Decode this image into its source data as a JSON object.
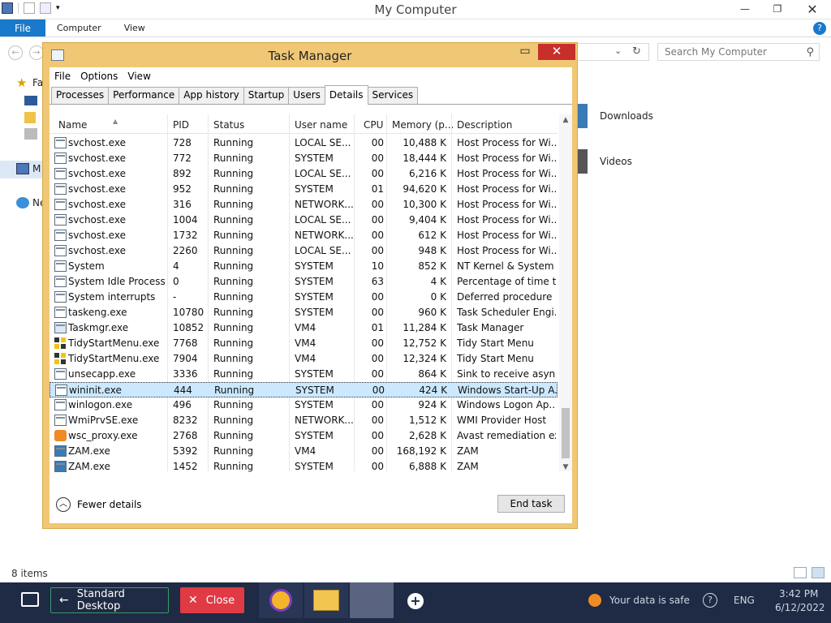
{
  "explorer": {
    "title": "My Computer",
    "ribbon_tabs": [
      "File",
      "Computer",
      "View"
    ],
    "help": "?",
    "search_placeholder": "Search My Computer",
    "sidebar": [
      {
        "label": "Fa",
        "icon": "star-icon"
      },
      {
        "label": "M",
        "icon": "computer-icon"
      },
      {
        "label": "Ne",
        "icon": "network-icon"
      }
    ],
    "folders": [
      {
        "label": "Downloads",
        "icon": "downloads-folder-icon"
      },
      {
        "label": "Videos",
        "icon": "videos-folder-icon"
      }
    ],
    "status_items": "8 items"
  },
  "taskmanager": {
    "title": "Task Manager",
    "menu": [
      "File",
      "Options",
      "View"
    ],
    "tabs": [
      "Processes",
      "Performance",
      "App history",
      "Startup",
      "Users",
      "Details",
      "Services"
    ],
    "active_tab": "Details",
    "columns": [
      "Name",
      "PID",
      "Status",
      "User name",
      "CPU",
      "Memory (p...",
      "Description"
    ],
    "rows": [
      {
        "name": "svchost.exe",
        "pid": "728",
        "status": "Running",
        "user": "LOCAL SE...",
        "cpu": "00",
        "mem": "10,488 K",
        "desc": "Host Process for Wi...",
        "icon": "generic"
      },
      {
        "name": "svchost.exe",
        "pid": "772",
        "status": "Running",
        "user": "SYSTEM",
        "cpu": "00",
        "mem": "18,444 K",
        "desc": "Host Process for Wi...",
        "icon": "generic"
      },
      {
        "name": "svchost.exe",
        "pid": "892",
        "status": "Running",
        "user": "LOCAL SE...",
        "cpu": "00",
        "mem": "6,216 K",
        "desc": "Host Process for Wi...",
        "icon": "generic"
      },
      {
        "name": "svchost.exe",
        "pid": "952",
        "status": "Running",
        "user": "SYSTEM",
        "cpu": "01",
        "mem": "94,620 K",
        "desc": "Host Process for Wi...",
        "icon": "generic"
      },
      {
        "name": "svchost.exe",
        "pid": "316",
        "status": "Running",
        "user": "NETWORK...",
        "cpu": "00",
        "mem": "10,300 K",
        "desc": "Host Process for Wi...",
        "icon": "generic"
      },
      {
        "name": "svchost.exe",
        "pid": "1004",
        "status": "Running",
        "user": "LOCAL SE...",
        "cpu": "00",
        "mem": "9,404 K",
        "desc": "Host Process for Wi...",
        "icon": "generic"
      },
      {
        "name": "svchost.exe",
        "pid": "1732",
        "status": "Running",
        "user": "NETWORK...",
        "cpu": "00",
        "mem": "612 K",
        "desc": "Host Process for Wi...",
        "icon": "generic"
      },
      {
        "name": "svchost.exe",
        "pid": "2260",
        "status": "Running",
        "user": "LOCAL SE...",
        "cpu": "00",
        "mem": "948 K",
        "desc": "Host Process for Wi...",
        "icon": "generic"
      },
      {
        "name": "System",
        "pid": "4",
        "status": "Running",
        "user": "SYSTEM",
        "cpu": "10",
        "mem": "852 K",
        "desc": "NT Kernel & System",
        "icon": "generic"
      },
      {
        "name": "System Idle Process",
        "pid": "0",
        "status": "Running",
        "user": "SYSTEM",
        "cpu": "63",
        "mem": "4 K",
        "desc": "Percentage of time t...",
        "icon": "generic"
      },
      {
        "name": "System interrupts",
        "pid": "-",
        "status": "Running",
        "user": "SYSTEM",
        "cpu": "00",
        "mem": "0 K",
        "desc": "Deferred procedure ...",
        "icon": "generic"
      },
      {
        "name": "taskeng.exe",
        "pid": "10780",
        "status": "Running",
        "user": "SYSTEM",
        "cpu": "00",
        "mem": "960 K",
        "desc": "Task Scheduler Engi...",
        "icon": "generic"
      },
      {
        "name": "Taskmgr.exe",
        "pid": "10852",
        "status": "Running",
        "user": "VM4",
        "cpu": "01",
        "mem": "11,284 K",
        "desc": "Task Manager",
        "icon": "tm"
      },
      {
        "name": "TidyStartMenu.exe",
        "pid": "7768",
        "status": "Running",
        "user": "VM4",
        "cpu": "00",
        "mem": "12,752 K",
        "desc": "Tidy Start Menu",
        "icon": "tidy"
      },
      {
        "name": "TidyStartMenu.exe",
        "pid": "7904",
        "status": "Running",
        "user": "VM4",
        "cpu": "00",
        "mem": "12,324 K",
        "desc": "Tidy Start Menu",
        "icon": "tidy"
      },
      {
        "name": "unsecapp.exe",
        "pid": "3336",
        "status": "Running",
        "user": "SYSTEM",
        "cpu": "00",
        "mem": "864 K",
        "desc": "Sink to receive asyn...",
        "icon": "generic"
      },
      {
        "name": "wininit.exe",
        "pid": "444",
        "status": "Running",
        "user": "SYSTEM",
        "cpu": "00",
        "mem": "424 K",
        "desc": "Windows Start-Up A...",
        "icon": "generic",
        "selected": true
      },
      {
        "name": "winlogon.exe",
        "pid": "496",
        "status": "Running",
        "user": "SYSTEM",
        "cpu": "00",
        "mem": "924 K",
        "desc": "Windows Logon Ap...",
        "icon": "generic"
      },
      {
        "name": "WmiPrvSE.exe",
        "pid": "8232",
        "status": "Running",
        "user": "NETWORK...",
        "cpu": "00",
        "mem": "1,512 K",
        "desc": "WMI Provider Host",
        "icon": "generic"
      },
      {
        "name": "wsc_proxy.exe",
        "pid": "2768",
        "status": "Running",
        "user": "SYSTEM",
        "cpu": "00",
        "mem": "2,628 K",
        "desc": "Avast remediation exe",
        "icon": "avast"
      },
      {
        "name": "ZAM.exe",
        "pid": "5392",
        "status": "Running",
        "user": "VM4",
        "cpu": "00",
        "mem": "168,192 K",
        "desc": "ZAM",
        "icon": "zam"
      },
      {
        "name": "ZAM.exe",
        "pid": "1452",
        "status": "Running",
        "user": "SYSTEM",
        "cpu": "00",
        "mem": "6,888 K",
        "desc": "ZAM",
        "icon": "zam"
      }
    ],
    "fewer_details": "Fewer details",
    "end_task": "End task"
  },
  "taskbar": {
    "standard_desktop": "Standard Desktop",
    "close": "Close",
    "data_safe": "Your data is safe",
    "language": "ENG",
    "time": "3:42 PM",
    "date": "6/12/2022"
  },
  "colors": {
    "accent": "#1979ca",
    "tm_frame": "#f0c774",
    "close_red": "#c7302a",
    "taskbar_bg": "#1f2a44",
    "close_btn": "#e03a45",
    "selection": "#cce8ff"
  }
}
